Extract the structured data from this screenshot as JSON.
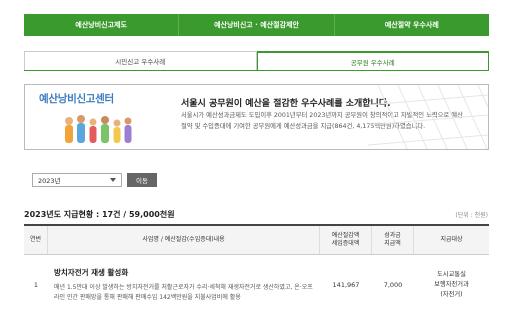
{
  "top_tabs": [
    "예산낭비신고제도",
    "예산낭비신고 · 예산절감제안",
    "예산절약 우수사례"
  ],
  "sub_tabs": [
    "시민신고 우수사례",
    "공무원 우수사례"
  ],
  "banner": {
    "logo_text": "예산낭비신고센터",
    "title": "서울시 공무원이 예산을 절감한 우수사례를 소개합니다.",
    "desc": "서울시가 예산성과금제도 도입이후 2001년부터 2023년까지 공무원이 창의적이고 자발적인 노력으로 예산절약 및 수입증대에 기여한 공무원에게 예산성과금을 지급(864건, 4,175백만원)하였습니다."
  },
  "filter": {
    "year": "2023년",
    "button": "이동"
  },
  "summary": "2023년도 지급현황 : 17건 / 59,000천원",
  "unit": "(단위 : 천원)",
  "table": {
    "headers": [
      "연번",
      "사업명 / 예산절감(수입증대)내용",
      "예산절감액\n세입증대액",
      "성과금\n지급액",
      "지급대상"
    ],
    "rows": [
      {
        "no": "1",
        "title": "방치자전거 재생 활성화",
        "desc": "매년 1.5만대 이상 발생하는 방치자전거를 처활근로자가 수리·세척해 재생자전거로 생산하였고, 온·오프라인 민간 판매망을 통해 판매해 판매수입 142백만원을 지불사업비에 활용",
        "amount": "141,967",
        "bonus": "7,000",
        "target": "도시교통실\n보행자전거과\n(자전거)"
      }
    ]
  },
  "colors": {
    "primary_green": "#3b9a2e",
    "button_gray": "#666666"
  }
}
